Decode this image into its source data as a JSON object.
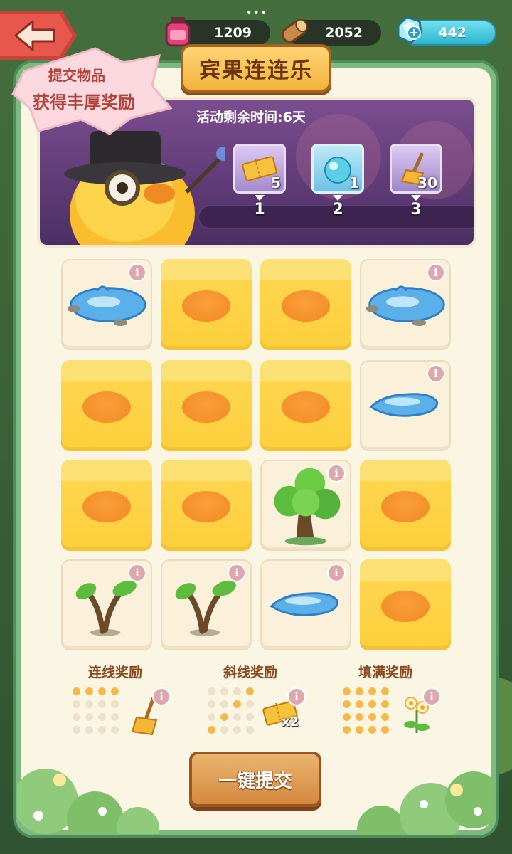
{
  "resources": {
    "ink": {
      "value": "1209",
      "icon": "ink-bottle-icon"
    },
    "wood": {
      "value": "2052",
      "icon": "wood-log-icon"
    },
    "gem": {
      "value": "442",
      "icon": "gem-icon"
    }
  },
  "header": {
    "more": "•••",
    "title": "宾果连连乐"
  },
  "promo_tag": {
    "line1": "提交物品",
    "line2": "获得丰厚奖励"
  },
  "banner": {
    "timer": "活动剩余时间:6天",
    "rewards": [
      {
        "icon": "ticket-icon",
        "count": "5",
        "milestone": "1"
      },
      {
        "icon": "water-orb-icon",
        "count": "1",
        "milestone": "2"
      },
      {
        "icon": "broom-icon",
        "count": "30",
        "milestone": "3"
      }
    ]
  },
  "grid": [
    [
      "puddle-large",
      "duck",
      "duck",
      "puddle-large"
    ],
    [
      "duck",
      "duck",
      "duck",
      "puddle-small"
    ],
    [
      "duck",
      "duck",
      "tree",
      "duck"
    ],
    [
      "sapling",
      "sapling",
      "puddle-small",
      "duck"
    ]
  ],
  "bottom_rewards": {
    "line": {
      "label": "连线奖励",
      "icon": "broom-icon"
    },
    "diagonal": {
      "label": "斜线奖励",
      "icon": "ticket-icon",
      "multiplier": "x2"
    },
    "full": {
      "label": "填满奖励",
      "icon": "flower-plant-icon"
    }
  },
  "submit_button": {
    "label": "一键提交"
  },
  "colors": {
    "panel_border": "#7dba82",
    "duck_yellow": "#fdcf3c",
    "beak_orange": "#f08a22",
    "banner_purple": "#5d3c76",
    "button_brown": "#d4893e"
  }
}
